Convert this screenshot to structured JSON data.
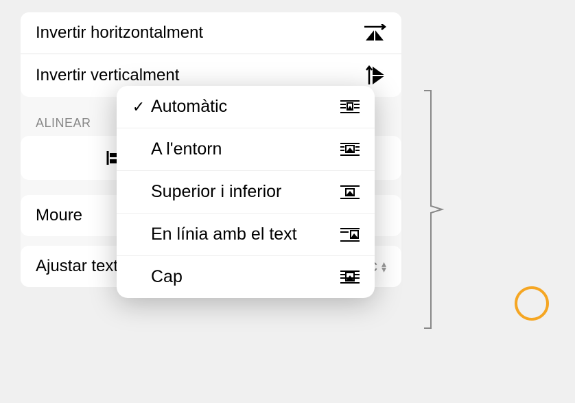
{
  "flip": {
    "horizontal_label": "Invertir horitzontalment",
    "vertical_label": "Invertir verticalment"
  },
  "align": {
    "header": "ALINEAR"
  },
  "move": {
    "label": "Moure"
  },
  "wrap": {
    "label": "Ajustar text",
    "value": "Automàtic"
  },
  "popup": {
    "items": [
      {
        "label": "Automàtic",
        "selected": true
      },
      {
        "label": "A l'entorn",
        "selected": false
      },
      {
        "label": "Superior i inferior",
        "selected": false
      },
      {
        "label": "En línia amb el text",
        "selected": false
      },
      {
        "label": "Cap",
        "selected": false
      }
    ]
  }
}
